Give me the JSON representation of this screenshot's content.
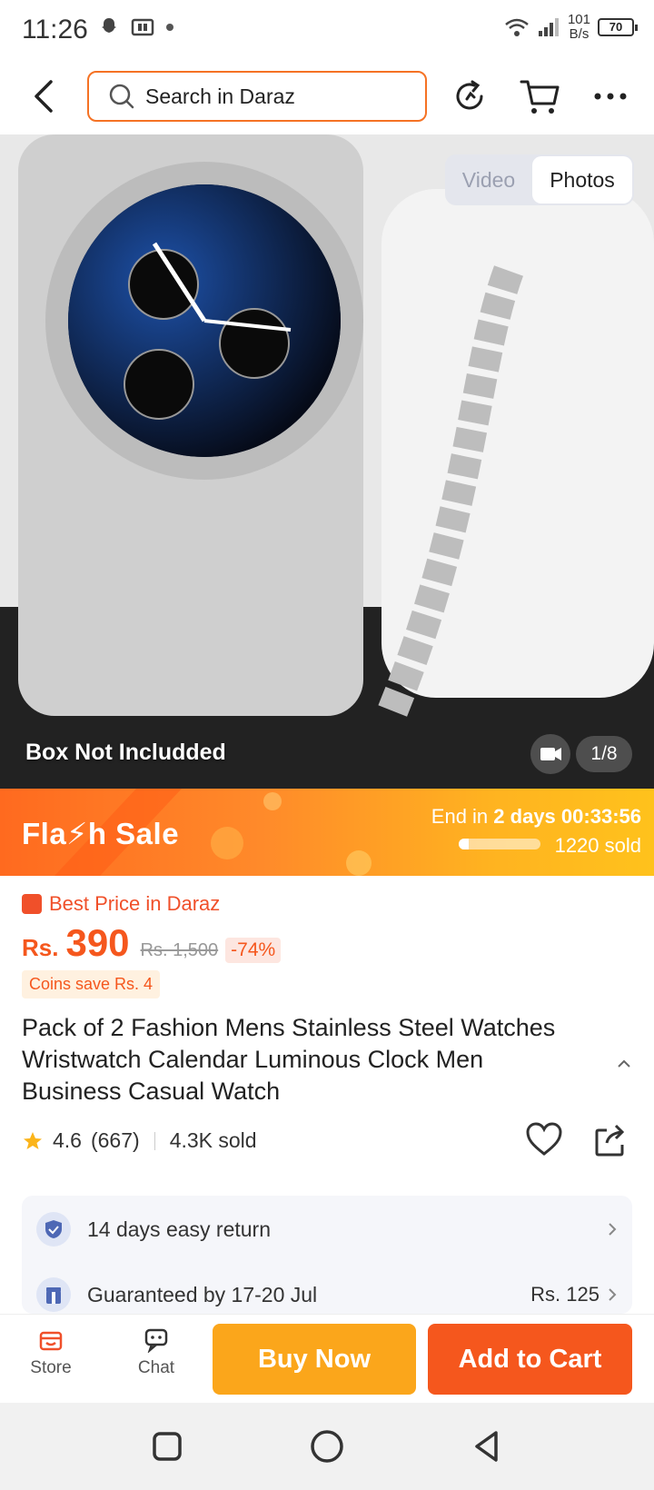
{
  "status_bar": {
    "time": "11:26",
    "net_speed_value": "101",
    "net_speed_unit": "B/s",
    "battery": "70"
  },
  "header": {
    "search_placeholder": "Search in Daraz"
  },
  "gallery": {
    "tab_video": "Video",
    "tab_photos": "Photos",
    "active_tab": "Photos",
    "overlay_note": "Box Not Includded",
    "page_counter": "1/8"
  },
  "flash_sale": {
    "title": "Fla⚡h  Sale",
    "ends_prefix": "End in",
    "ends_days": "2 days",
    "ends_time": "00:33:56",
    "sold": "1220 sold",
    "sold_progress": 0.12
  },
  "product": {
    "badge": "Best Price in Daraz",
    "currency": "Rs.",
    "price": "390",
    "original_price": "Rs. 1,500",
    "discount": "-74%",
    "coins_note": "Coins save Rs. 4",
    "title": "Pack of 2 Fashion Mens Stainless Steel Watches Wristwatch Calendar Luminous Clock Men Business Casual Watch",
    "rating": "4.6",
    "rating_count": "(667)",
    "sold": "4.3K sold"
  },
  "services": [
    {
      "label": "14 days easy return",
      "right": ""
    },
    {
      "label": "Guaranteed by 17-20 Jul",
      "right": "Rs. 125"
    }
  ],
  "action_bar": {
    "store": "Store",
    "chat": "Chat",
    "buy_now": "Buy Now",
    "add_to_cart": "Add to Cart"
  },
  "colors": {
    "accent": "#f5571d",
    "buy_now": "#fba61b",
    "search_border": "#f57224"
  }
}
